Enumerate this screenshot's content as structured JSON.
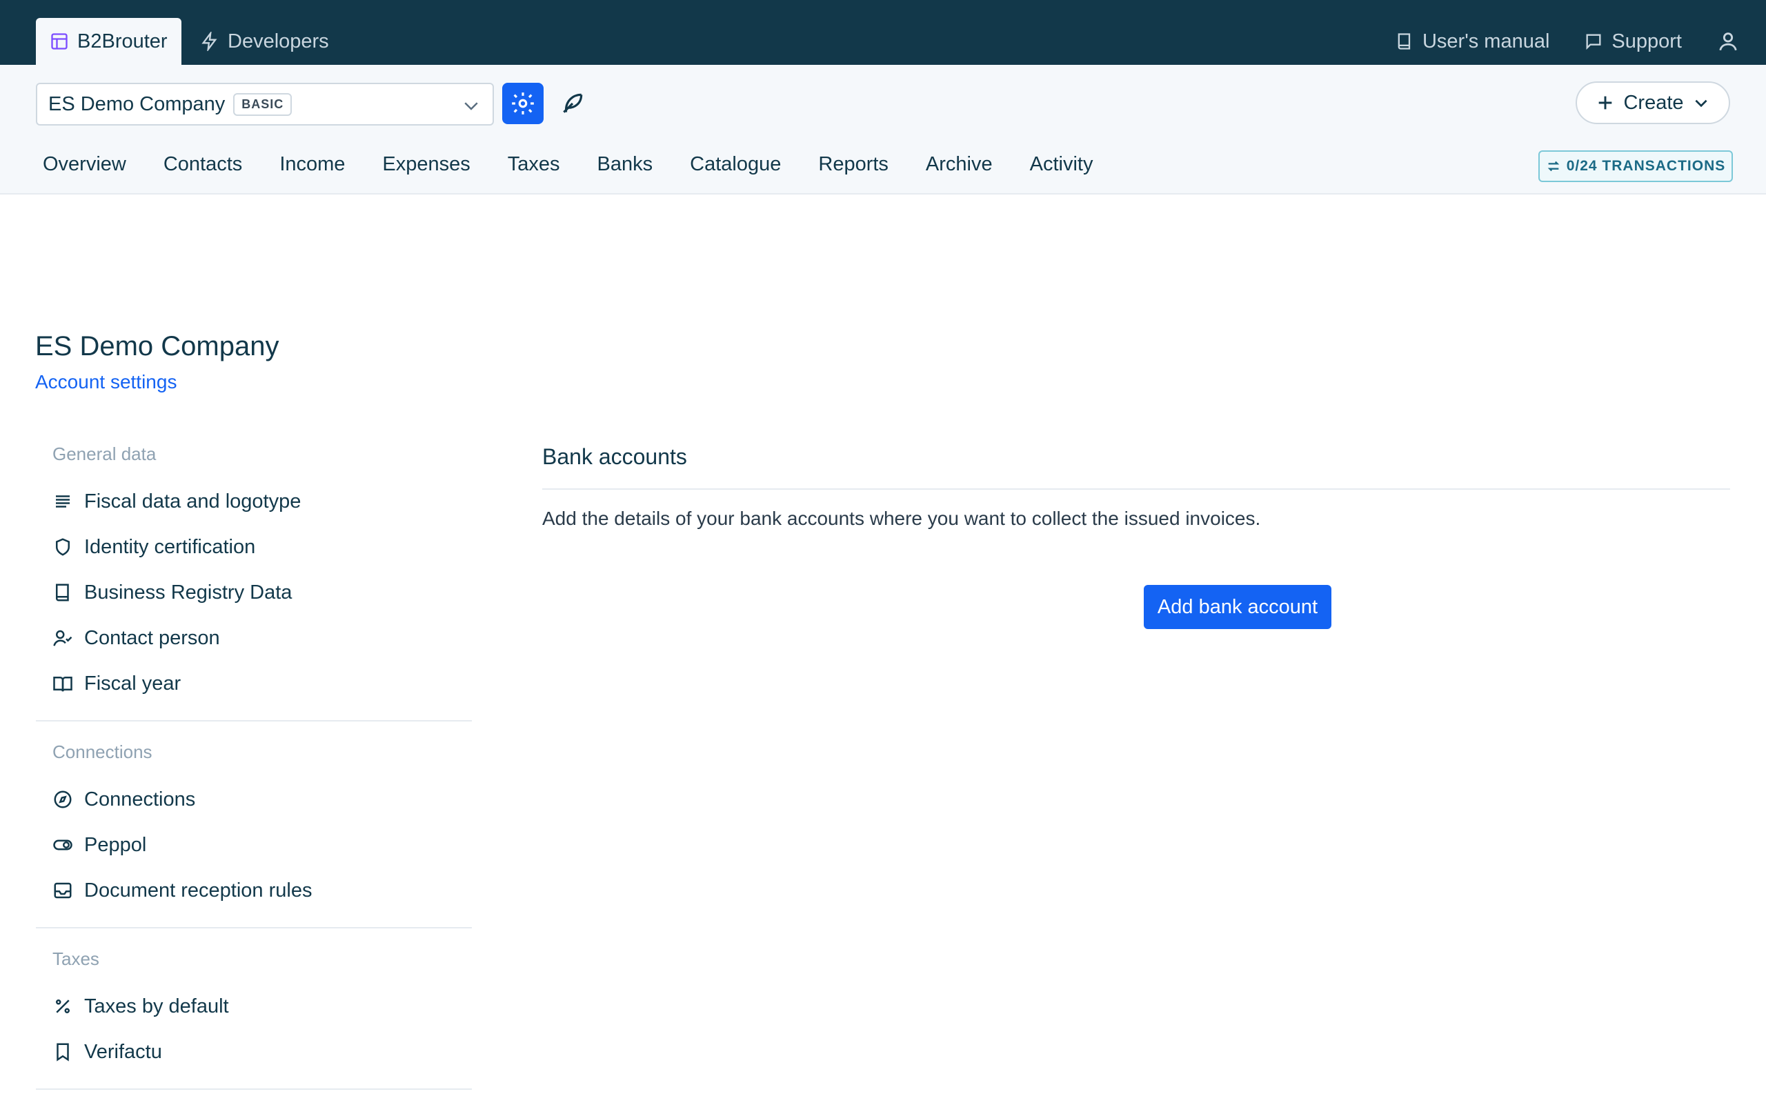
{
  "topbar": {
    "app_tab": "B2Brouter",
    "dev_tab": "Developers",
    "manual": "User's manual",
    "support": "Support"
  },
  "company": {
    "name": "ES Demo Company",
    "plan": "BASIC"
  },
  "create_label": "Create",
  "nav": [
    "Overview",
    "Contacts",
    "Income",
    "Expenses",
    "Taxes",
    "Banks",
    "Catalogue",
    "Reports",
    "Archive",
    "Activity"
  ],
  "transactions": "0/24 TRANSACTIONS",
  "page": {
    "title": "ES Demo Company",
    "subtitle": "Account settings"
  },
  "sidebar": {
    "groups": [
      {
        "title": "General data",
        "items": [
          "Fiscal data and logotype",
          "Identity certification",
          "Business Registry Data",
          "Contact person",
          "Fiscal year"
        ]
      },
      {
        "title": "Connections",
        "items": [
          "Connections",
          "Peppol",
          "Document reception rules"
        ]
      },
      {
        "title": "Taxes",
        "items": [
          "Taxes by default",
          "Verifactu"
        ]
      }
    ]
  },
  "content": {
    "title": "Bank accounts",
    "description": "Add the details of your bank accounts where you want to collect the issued invoices.",
    "add_button": "Add bank account"
  },
  "colors": {
    "topbar": "#12384a",
    "accent": "#1463f3",
    "muted": "#8fa2b2"
  }
}
